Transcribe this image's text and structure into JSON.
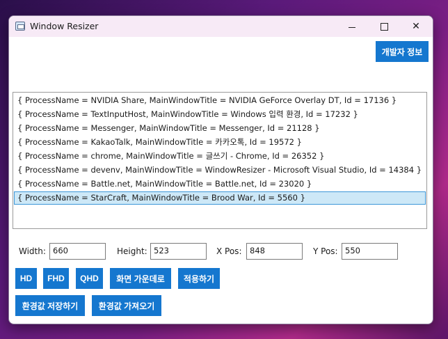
{
  "window": {
    "title": "Window Resizer",
    "minimize_label": "—",
    "maximize_label": "□",
    "close_label": "✕"
  },
  "header": {
    "developer_info_label": "개발자 정보"
  },
  "process_list": {
    "items": [
      "{ ProcessName = NVIDIA Share, MainWindowTitle = NVIDIA GeForce Overlay DT, Id = 17136 }",
      "{ ProcessName = TextInputHost, MainWindowTitle = Windows 입력 환경, Id = 17232 }",
      "{ ProcessName = Messenger, MainWindowTitle = Messenger, Id = 21128 }",
      "{ ProcessName = KakaoTalk, MainWindowTitle = 카카오톡, Id = 19572 }",
      "{ ProcessName = chrome, MainWindowTitle = 글쓰기 - Chrome, Id = 26352 }",
      "{ ProcessName = devenv, MainWindowTitle = WindowResizer - Microsoft Visual Studio, Id = 14384 }",
      "{ ProcessName = Battle.net, MainWindowTitle = Battle.net, Id = 23020 }",
      "{ ProcessName = StarCraft, MainWindowTitle = Brood War, Id = 5560 }"
    ],
    "selected_index": 7
  },
  "fields": {
    "width_label": "Width:",
    "width_value": "660",
    "height_label": "Height:",
    "height_value": "523",
    "xpos_label": "X Pos:",
    "xpos_value": "848",
    "ypos_label": "Y Pos:",
    "ypos_value": "550"
  },
  "buttons": {
    "hd": "HD",
    "fhd": "FHD",
    "qhd": "QHD",
    "center": "화면 가운데로",
    "apply": "적용하기",
    "save_settings": "환경값 저장하기",
    "load_settings": "환경값 가져오기"
  },
  "colors": {
    "accent": "#1577cf",
    "selection": "#cde8f7",
    "titlebar": "#f7eaf6"
  }
}
